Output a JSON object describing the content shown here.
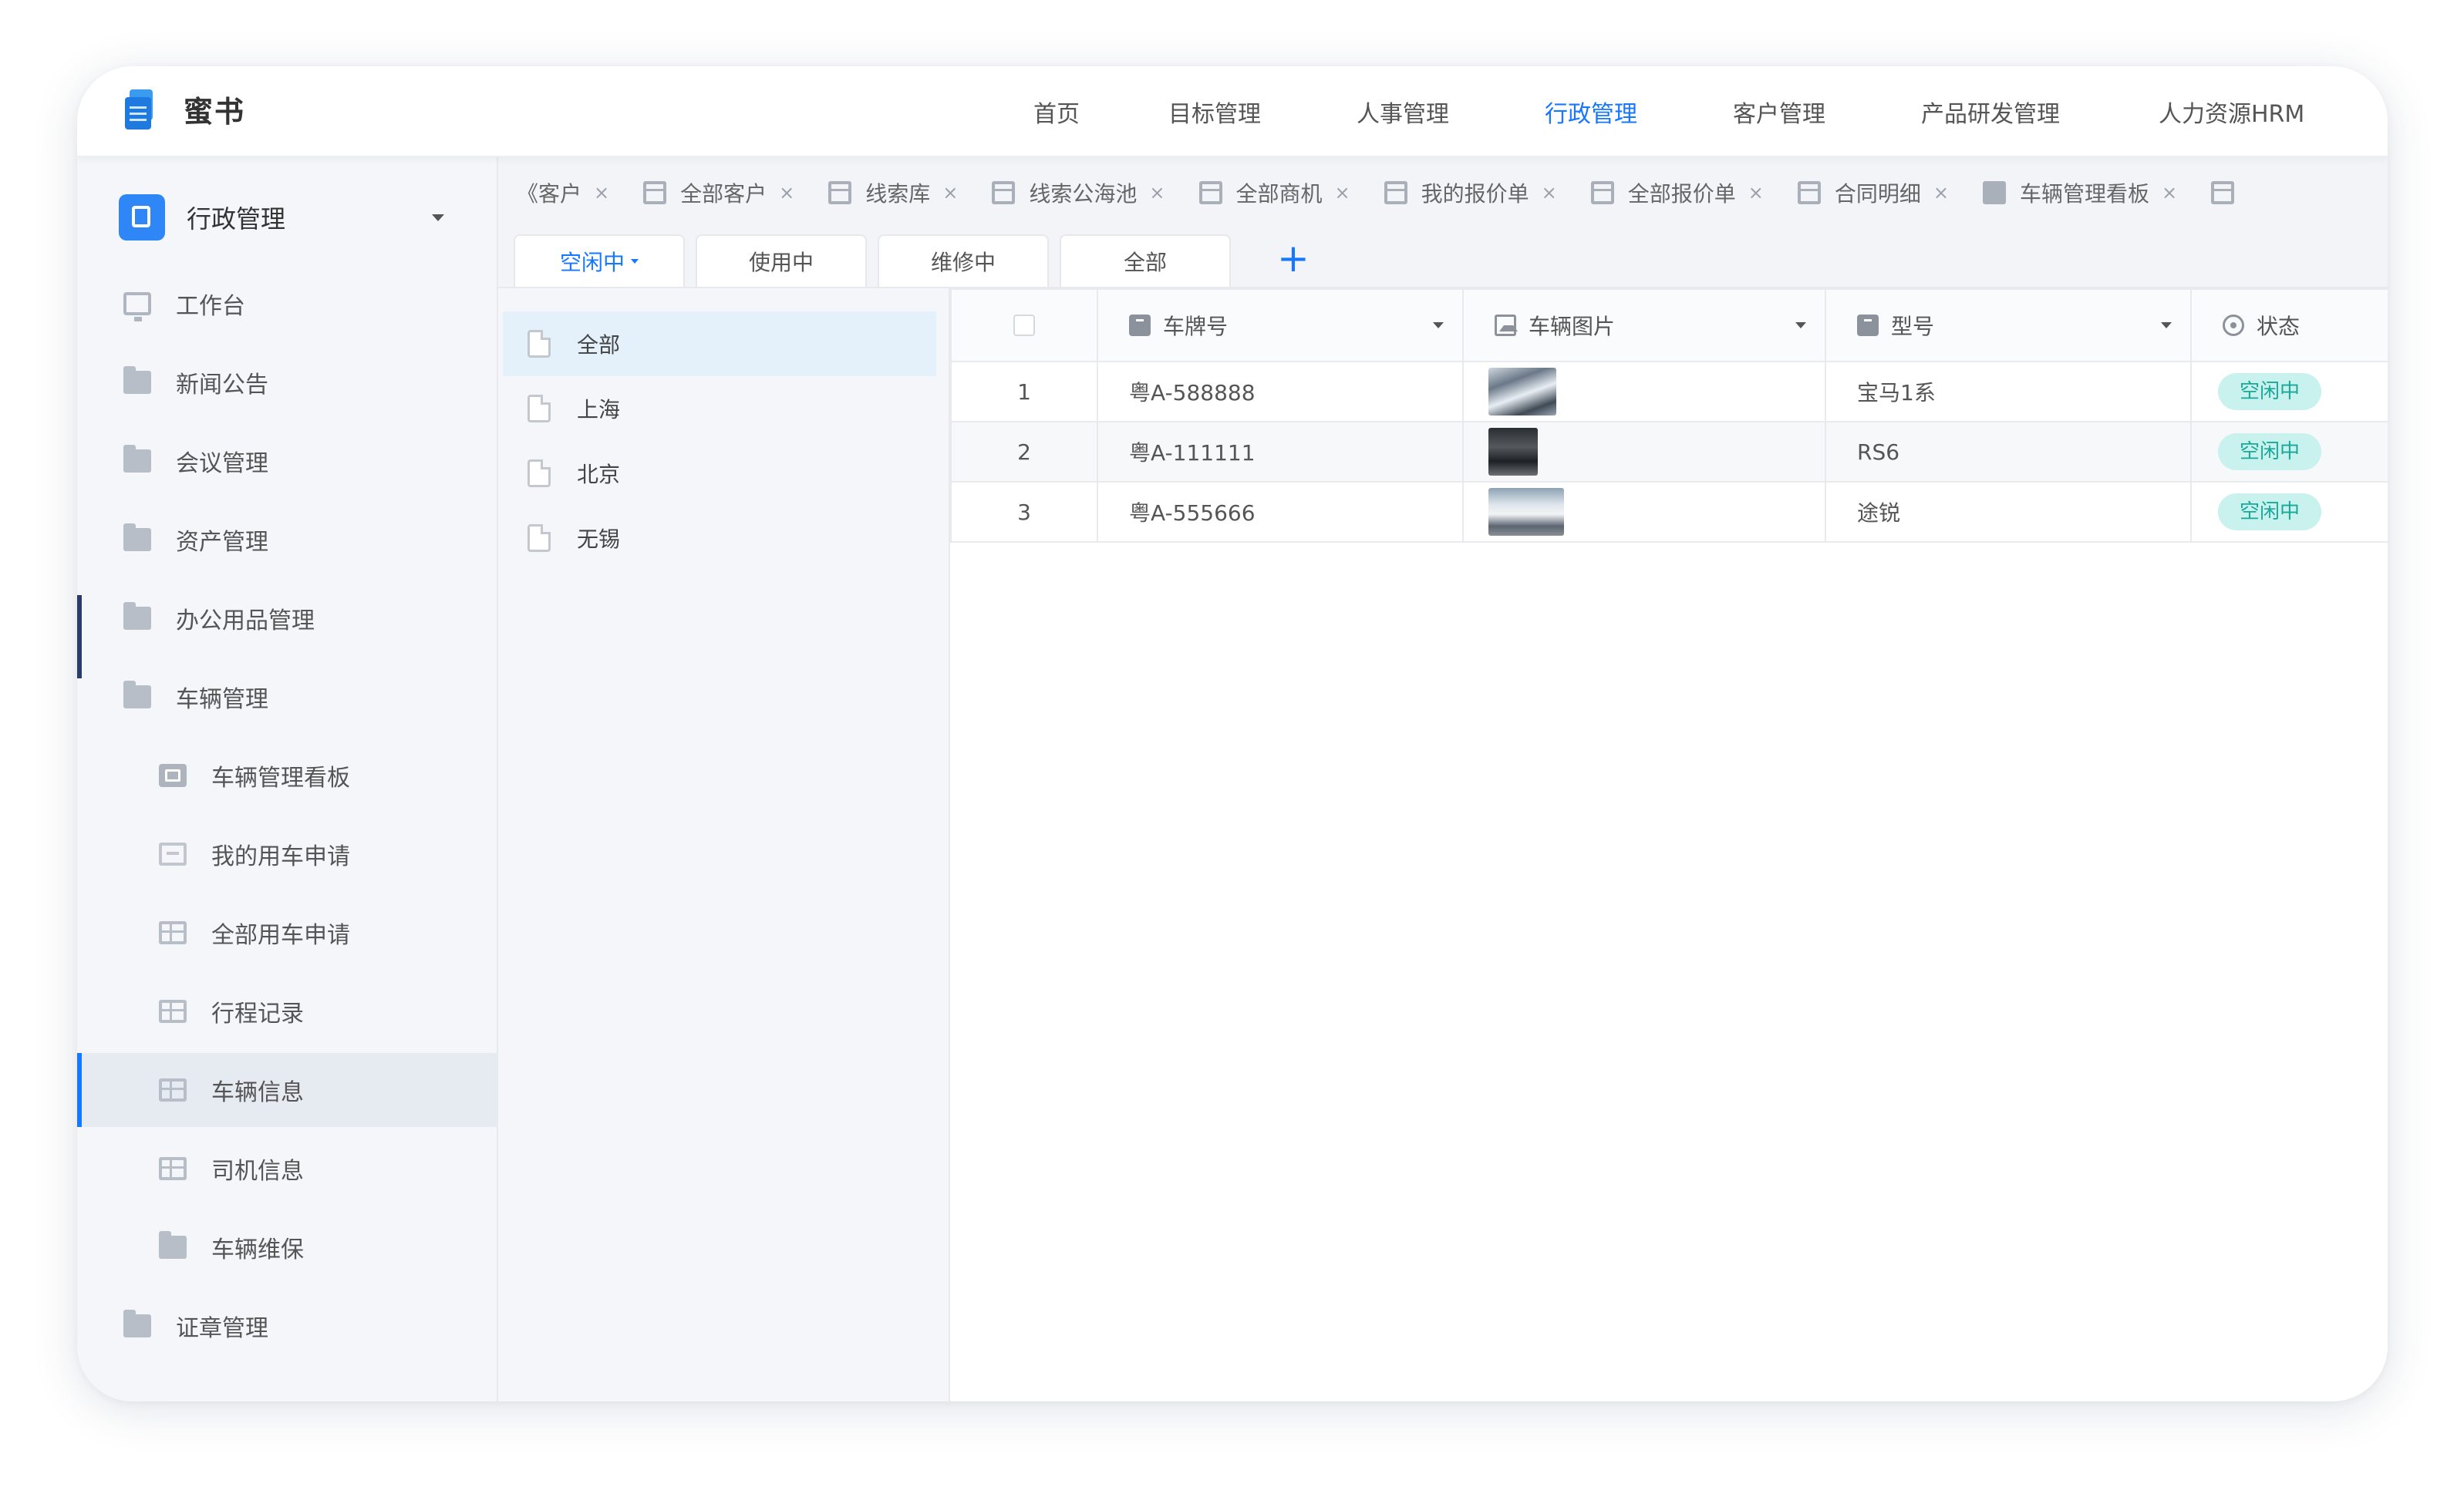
{
  "app": {
    "name": "蜜书"
  },
  "topnav": [
    {
      "label": "首页",
      "active": false
    },
    {
      "label": "目标管理",
      "active": false
    },
    {
      "label": "人事管理",
      "active": false
    },
    {
      "label": "行政管理",
      "active": true
    },
    {
      "label": "客户管理",
      "active": false
    },
    {
      "label": "产品研发管理",
      "active": false
    },
    {
      "label": "人力资源HRM",
      "active": false
    }
  ],
  "sidebar": {
    "header": "行政管理",
    "items": [
      {
        "label": "工作台",
        "icon": "monitor-icon",
        "level": 0
      },
      {
        "label": "新闻公告",
        "icon": "folder-icon",
        "level": 0
      },
      {
        "label": "会议管理",
        "icon": "folder-icon",
        "level": 0
      },
      {
        "label": "资产管理",
        "icon": "folder-icon",
        "level": 0
      },
      {
        "label": "办公用品管理",
        "icon": "folder-icon",
        "level": 0
      },
      {
        "label": "车辆管理",
        "icon": "folder-open-icon",
        "level": 0
      },
      {
        "label": "车辆管理看板",
        "icon": "board-icon",
        "level": 1
      },
      {
        "label": "我的用车申请",
        "icon": "form-icon",
        "level": 1
      },
      {
        "label": "全部用车申请",
        "icon": "table-icon",
        "level": 1
      },
      {
        "label": "行程记录",
        "icon": "table-icon",
        "level": 1
      },
      {
        "label": "车辆信息",
        "icon": "table-icon",
        "level": 1,
        "active": true
      },
      {
        "label": "司机信息",
        "icon": "table-icon",
        "level": 1
      },
      {
        "label": "车辆维保",
        "icon": "folder-icon",
        "level": 1
      },
      {
        "label": "证章管理",
        "icon": "folder-icon",
        "level": 0
      }
    ]
  },
  "view_tabs": [
    {
      "label": "《客户",
      "icon": ""
    },
    {
      "label": "全部客户",
      "icon": "table-icon"
    },
    {
      "label": "线索库",
      "icon": "table-icon"
    },
    {
      "label": "线索公海池",
      "icon": "form-icon"
    },
    {
      "label": "全部商机",
      "icon": "table-icon"
    },
    {
      "label": "我的报价单",
      "icon": "form-icon"
    },
    {
      "label": "全部报价单",
      "icon": "table-icon"
    },
    {
      "label": "合同明细",
      "icon": "table-icon"
    },
    {
      "label": "车辆管理看板",
      "icon": "board-icon"
    }
  ],
  "close_glyph": "×",
  "status_tabs": [
    {
      "label": "空闲中",
      "active": true
    },
    {
      "label": "使用中",
      "active": false
    },
    {
      "label": "维修中",
      "active": false
    },
    {
      "label": "全部",
      "active": false
    }
  ],
  "add_label": "+",
  "groups": [
    {
      "label": "全部",
      "active": true
    },
    {
      "label": "上海",
      "active": false
    },
    {
      "label": "北京",
      "active": false
    },
    {
      "label": "无锡",
      "active": false
    }
  ],
  "table": {
    "columns": [
      {
        "label": "车牌号",
        "icon": "text-field-icon"
      },
      {
        "label": "车辆图片",
        "icon": "image-field-icon"
      },
      {
        "label": "型号",
        "icon": "text-field-icon"
      },
      {
        "label": "状态",
        "icon": "status-field-icon"
      }
    ],
    "rows": [
      {
        "index": "1",
        "plate": "粤A-588888",
        "model": "宝马1系",
        "status": "空闲中"
      },
      {
        "index": "2",
        "plate": "粤A-111111",
        "model": "RS6",
        "status": "空闲中"
      },
      {
        "index": "3",
        "plate": "粤A-555666",
        "model": "途锐",
        "status": "空闲中"
      }
    ]
  },
  "colors": {
    "accent": "#1677ff",
    "status_bg": "#c9f1ee",
    "status_text": "#18a999"
  }
}
